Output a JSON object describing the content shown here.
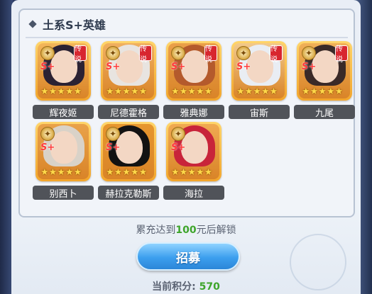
{
  "section": {
    "title": "土系S+英雄"
  },
  "heroes": [
    {
      "name": "辉夜姬",
      "rank": "S+",
      "stars": "★★★★★",
      "badge": "传说",
      "hair": "#2b2233",
      "bg": "#f3b65a"
    },
    {
      "name": "尼德霍格",
      "rank": "S+",
      "stars": "★★★★★",
      "badge": "传说",
      "hair": "#e8e4e0",
      "bg": "#f0b060"
    },
    {
      "name": "雅典娜",
      "rank": "S+",
      "stars": "★★★★★",
      "badge": "传说",
      "hair": "#b45a2c",
      "bg": "#eaa04a"
    },
    {
      "name": "宙斯",
      "rank": "S+",
      "stars": "★★★★★",
      "badge": "传说",
      "hair": "#e9edf3",
      "bg": "#f2c98a"
    },
    {
      "name": "九尾",
      "rank": "S+",
      "stars": "★★★★★",
      "badge": "传说",
      "hair": "#3a2a28",
      "bg": "#f0b058"
    },
    {
      "name": "别西卜",
      "rank": "S+",
      "stars": "★★★★★",
      "badge": "",
      "hair": "#d9d2c8",
      "bg": "#e9a24a"
    },
    {
      "name": "赫拉克勒斯",
      "rank": "S+",
      "stars": "★★★★★",
      "badge": "",
      "hair": "#121212",
      "bg": "#e6962e"
    },
    {
      "name": "海拉",
      "rank": "S+",
      "stars": "★★★★★",
      "badge": "",
      "hair": "#c8243a",
      "bg": "#f0aa52"
    }
  ],
  "unlock": {
    "prefix": "累充达到",
    "amount": "100",
    "suffix": "元后解锁"
  },
  "recruit": {
    "label": "招募"
  },
  "points": {
    "label": "当前积分:",
    "value": "570"
  }
}
